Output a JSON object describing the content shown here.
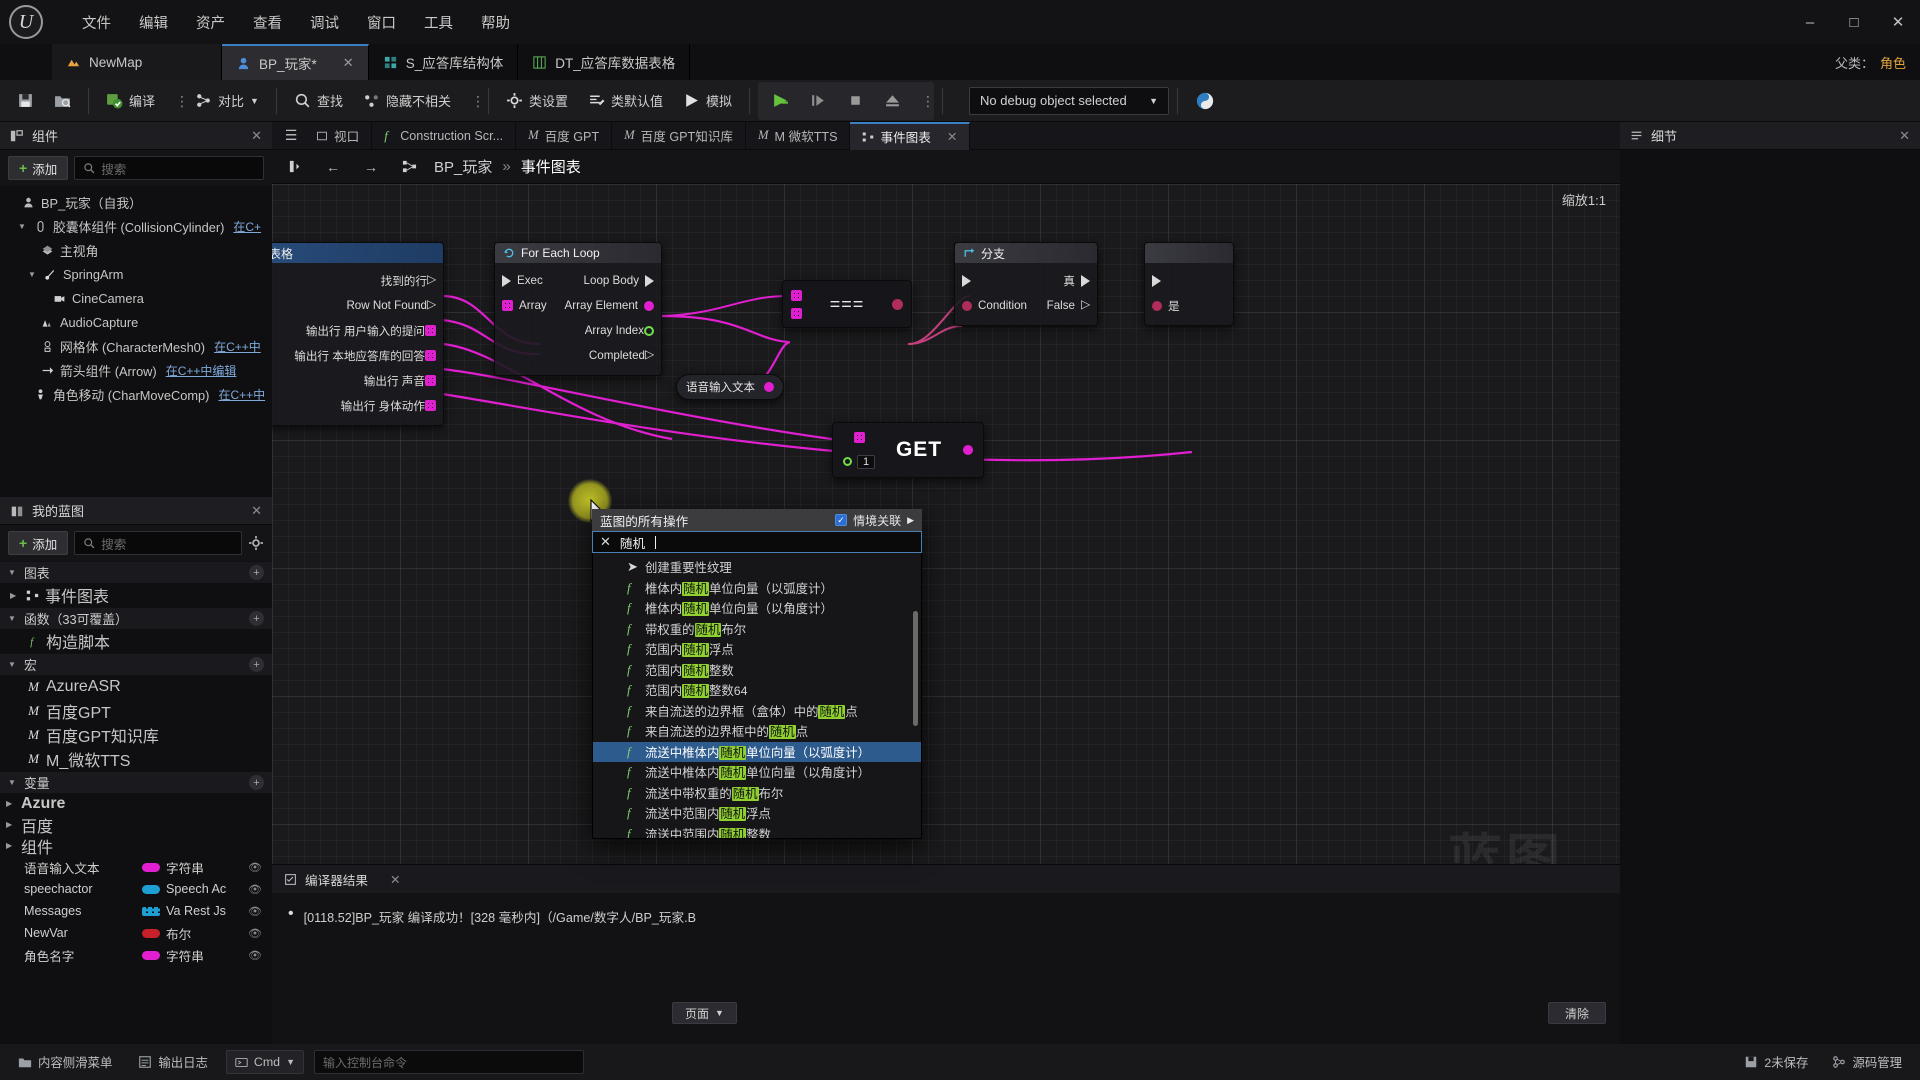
{
  "menu": {
    "logo_icon": "unreal-engine-logo",
    "items": [
      "文件",
      "编辑",
      "资产",
      "查看",
      "调试",
      "窗口",
      "工具",
      "帮助"
    ],
    "window_controls": [
      "minimize",
      "maximize",
      "close"
    ]
  },
  "asset_tabs": {
    "level_tab": {
      "label": "NewMap",
      "icon": "level-icon"
    },
    "tabs": [
      {
        "label": "BP_玩家*",
        "icon": "blueprint-icon",
        "active": true,
        "closable": true
      },
      {
        "label": "S_应答库结构体",
        "icon": "struct-icon",
        "active": false,
        "closable": false
      },
      {
        "label": "DT_应答库数据表格",
        "icon": "datatable-icon",
        "active": false,
        "closable": false
      }
    ],
    "parent_label": "父类：",
    "parent_value": "角色"
  },
  "toolbar": {
    "save_icon": "save-icon",
    "browse_icon": "browse-content-icon",
    "compile_label": "编译",
    "diff_label": "对比",
    "find_label": "查找",
    "hide_unrelated_label": "隐藏不相关",
    "class_settings_label": "类设置",
    "class_defaults_label": "类默认值",
    "simulate_label": "模拟",
    "play_icon": "play-icon",
    "step_icon": "step-icon",
    "stop_icon": "stop-icon",
    "eject_icon": "eject-icon",
    "debug_object": "No debug object selected",
    "platform_icon": "platforms-icon"
  },
  "components_panel": {
    "title": "组件",
    "add_label": "添加",
    "search_placeholder": "搜索",
    "tree": [
      {
        "indent": 0,
        "label": "BP_玩家（自我）",
        "icon": "actor-icon",
        "arrow": "none",
        "cpp": ""
      },
      {
        "indent": 1,
        "label": "胶囊体组件 (CollisionCylinder)",
        "icon": "capsule-icon",
        "arrow": "down",
        "cpp": "在C+"
      },
      {
        "indent": 2,
        "label": "主视角",
        "icon": "mesh-icon",
        "arrow": "none",
        "cpp": ""
      },
      {
        "indent": 2,
        "label": "SpringArm",
        "icon": "springarm-icon",
        "arrow": "down",
        "cpp": ""
      },
      {
        "indent": 3,
        "label": "CineCamera",
        "icon": "camera-icon",
        "arrow": "none",
        "cpp": ""
      },
      {
        "indent": 2,
        "label": "AudioCapture",
        "icon": "audio-icon",
        "arrow": "none",
        "cpp": ""
      },
      {
        "indent": 2,
        "label": "网格体 (CharacterMesh0)",
        "icon": "skeletalmesh-icon",
        "arrow": "none",
        "cpp": "在C++中"
      },
      {
        "indent": 2,
        "label": "箭头组件 (Arrow)",
        "icon": "arrow-icon",
        "arrow": "none",
        "cpp": "在C++中编辑"
      },
      {
        "indent": 1,
        "label": "角色移动 (CharMoveComp)",
        "icon": "movement-icon",
        "arrow": "none",
        "cpp": "在C++中"
      }
    ]
  },
  "myblueprint_panel": {
    "title": "我的蓝图",
    "add_label": "添加",
    "search_placeholder": "搜索",
    "sections": [
      {
        "label": "图表",
        "arrow": "down"
      },
      {
        "label": "函数（33可覆盖）",
        "arrow": "down"
      },
      {
        "label": "宏",
        "arrow": "down"
      },
      {
        "label": "变量",
        "arrow": "down"
      },
      {
        "label": "组件",
        "arrow": "down"
      }
    ],
    "graphs": [
      {
        "label": "事件图表",
        "icon": "eventgraph-icon"
      }
    ],
    "functions": [
      {
        "label": "构造脚本",
        "icon": "function-icon"
      }
    ],
    "macros": [
      {
        "label": "AzureASR",
        "icon": "macro-icon"
      },
      {
        "label": "百度GPT",
        "icon": "macro-icon"
      },
      {
        "label": "百度GPT知识库",
        "icon": "macro-icon"
      },
      {
        "label": "M_微软TTS",
        "icon": "macro-icon"
      }
    ],
    "var_categories": [
      {
        "label": "Azure"
      },
      {
        "label": "百度"
      },
      {
        "label": "组件"
      }
    ],
    "variables": [
      {
        "name": "语音输入文本",
        "type": "字符串",
        "pin": "#e01fd0",
        "pinstyle": "solid"
      },
      {
        "name": "speechactor",
        "type": "Speech Ac",
        "pin": "#1f9ed4",
        "pinstyle": "solid"
      },
      {
        "name": "Messages",
        "type": "Va Rest Js",
        "pin": "#1f9ed4",
        "pinstyle": "grid"
      },
      {
        "name": "NewVar",
        "type": "布尔",
        "pin": "#c8202a",
        "pinstyle": "solid"
      },
      {
        "name": "角色名字",
        "type": "字符串",
        "pin": "#e01fd0",
        "pinstyle": "solid"
      }
    ]
  },
  "graph_tabs": {
    "tabs": [
      {
        "label": "视口",
        "icon": "viewport-icon",
        "active": false
      },
      {
        "label": "Construction Scr...",
        "icon": "function-icon",
        "active": false
      },
      {
        "label": "百度 GPT",
        "icon": "macro-icon",
        "active": false
      },
      {
        "label": "百度 GPT知识库",
        "icon": "macro-icon",
        "active": false
      },
      {
        "label": "M 微软TTS",
        "icon": "macro-icon",
        "active": false
      },
      {
        "label": "事件图表",
        "icon": "eventgraph-icon",
        "active": true,
        "closable": true
      }
    ]
  },
  "graph_bar": {
    "menu_icon": "graph-menu-icon",
    "back_icon": "back-arrow-icon",
    "forward_icon": "forward-arrow-icon",
    "home_icon": "graph-home-icon",
    "breadcrumb_root": "BP_玩家",
    "breadcrumb_sep": "»",
    "breadcrumb_leaf": "事件图表",
    "zoom_label": "缩放1:1",
    "watermark": "蓝图"
  },
  "nodes": {
    "datatable": {
      "title": "库数据表格",
      "rows_out": [
        {
          "label": "找到的行",
          "kind": "exec-out"
        },
        {
          "label": "Row Not Found",
          "kind": "exec-out"
        },
        {
          "label": "输出行 用户输入的提问",
          "kind": "grid-magenta"
        },
        {
          "label": "输出行 本地应答库的回答",
          "kind": "grid-magenta"
        },
        {
          "label": "输出行 声音",
          "kind": "grid-magenta"
        },
        {
          "label": "输出行 身体动作",
          "kind": "grid-magenta"
        }
      ]
    },
    "foreach": {
      "title": "For Each Loop",
      "left": [
        {
          "label": "Exec",
          "kind": "exec-in"
        },
        {
          "label": "Array",
          "kind": "grid-magenta"
        }
      ],
      "right": [
        {
          "label": "Loop Body",
          "kind": "exec-out"
        },
        {
          "label": "Array Element",
          "kind": "dot-magenta"
        },
        {
          "label": "Array Index",
          "kind": "dot-green"
        },
        {
          "label": "Completed",
          "kind": "exec-out"
        }
      ]
    },
    "equal": {
      "symbol": "==="
    },
    "voice_var": {
      "label": "语音输入文本"
    },
    "get_node": {
      "title": "GET",
      "index": "1"
    },
    "branch": {
      "title": "分支",
      "left": [
        {
          "label": "",
          "kind": "exec-in"
        },
        {
          "label": "Condition",
          "kind": "dot-red"
        }
      ],
      "right": [
        {
          "label": "真",
          "kind": "exec-out"
        },
        {
          "label": "False",
          "kind": "exec-out"
        }
      ]
    },
    "far_right": {
      "label": "是"
    }
  },
  "popup": {
    "title": "蓝图的所有操作",
    "context_label": "情境关联",
    "context_checked": true,
    "search_value": "随机",
    "clear_icon": "clear-x-icon",
    "items": [
      {
        "icon": "arrow",
        "pre": "创建重要性纹理",
        "hl": "",
        "post": "",
        "selected": false
      },
      {
        "icon": "fx",
        "pre": "椎体内",
        "hl": "随机",
        "post": "单位向量（以弧度计）",
        "selected": false
      },
      {
        "icon": "fx",
        "pre": "椎体内",
        "hl": "随机",
        "post": "单位向量（以角度计）",
        "selected": false
      },
      {
        "icon": "fx",
        "pre": "带权重的",
        "hl": "随机",
        "post": "布尔",
        "selected": false
      },
      {
        "icon": "fx",
        "pre": "范围内",
        "hl": "随机",
        "post": "浮点",
        "selected": false
      },
      {
        "icon": "fx",
        "pre": "范围内",
        "hl": "随机",
        "post": "整数",
        "selected": false
      },
      {
        "icon": "fx",
        "pre": "范围内",
        "hl": "随机",
        "post": "整数64",
        "selected": false
      },
      {
        "icon": "fx",
        "pre": "来自流送的边界框（盒体）中的",
        "hl": "随机",
        "post": "点",
        "selected": false
      },
      {
        "icon": "fx",
        "pre": "来自流送的边界框中的",
        "hl": "随机",
        "post": "点",
        "selected": false
      },
      {
        "icon": "fx",
        "pre": "流送中椎体内",
        "hl": "随机",
        "post": "单位向量（以弧度计）",
        "selected": true
      },
      {
        "icon": "fx",
        "pre": "流送中椎体内",
        "hl": "随机",
        "post": "单位向量（以角度计）",
        "selected": false
      },
      {
        "icon": "fx",
        "pre": "流送中带权重的",
        "hl": "随机",
        "post": "布尔",
        "selected": false
      },
      {
        "icon": "fx",
        "pre": "流送中范围内",
        "hl": "随机",
        "post": "浮点",
        "selected": false
      },
      {
        "icon": "fx",
        "pre": "流送中范围内",
        "hl": "随机",
        "post": "整数",
        "selected": false
      }
    ]
  },
  "compiler": {
    "title": "编译器结果",
    "message": "[0118.52]BP_玩家 编译成功！[328 毫秒内]（/Game/数字人/BP_玩家.B",
    "page_label": "页面",
    "clear_label": "清除"
  },
  "details_panel": {
    "title": "细节"
  },
  "statusbar": {
    "content_drawer": "内容侧滑菜单",
    "output_log": "输出日志",
    "cmd_label": "Cmd",
    "cmd_placeholder": "输入控制台命令",
    "unsaved": "2未保存",
    "source_control": "源码管理"
  },
  "colors": {
    "accent_blue": "#3b7fc4",
    "highlight_green": "#90d130",
    "selection_blue": "#2d5b8e",
    "wire_magenta": "#e01fd0",
    "exec_white": "#d9d9d9",
    "compile_green": "#6abf4b"
  }
}
